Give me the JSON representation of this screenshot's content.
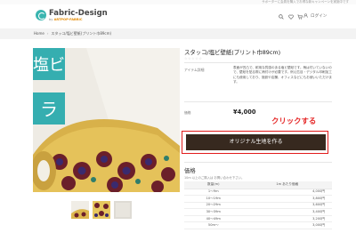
{
  "notice": "サポーターに会員を購入でお得な新キャンペーンを実施中です",
  "brand": {
    "name": "Fabric-Design",
    "sub_prefix": "by ",
    "sub_brand": "ARTPOP-FABRIC"
  },
  "header": {
    "login_label": "ログイン",
    "colors": {
      "accent": "#3ab5b0"
    }
  },
  "breadcrumb": {
    "home": "Home",
    "current": "スタッコ/塩ビ壁紙(プリント巾89cm)"
  },
  "gallery": {
    "overlay_chars": [
      "塩ビ",
      "ラ"
    ]
  },
  "product": {
    "title": "スタッコ/塩ビ壁紙(プリント巾89cm)",
    "stars": "☆☆☆☆☆",
    "detail_label": "アイテム詳細",
    "detail_text": "表面が凹凸で、耐用な質感のある塩ビ壁紙です。柄は付いていないので、壁紙を貼る際に柄付けが必要です。例え匹目・デジタル印刷加工にも使用しており、施設や店舗、オフィスなどにもお使いいただけます。",
    "price_label": "価格",
    "price": "¥4,000"
  },
  "annotation": "クリックする",
  "cta_label": "オリジナル生地を作る",
  "pricing": {
    "title": "価格",
    "note": "10m 以上のご購入は お問い合わせ下さい。",
    "headers": [
      "数量(m)",
      "1m あたり価格"
    ],
    "rows": [
      [
        "1〜9m",
        "4,000円"
      ],
      [
        "10〜19m",
        "3,800円"
      ],
      [
        "20〜29m",
        "3,600円"
      ],
      [
        "30〜39m",
        "3,400円"
      ],
      [
        "40〜49m",
        "3,200円"
      ],
      [
        "50m〜",
        "3,000円"
      ]
    ]
  },
  "colors": {
    "cta_bg": "#37291f",
    "highlight": "#e11b1b",
    "annotation": "#e52a2a"
  }
}
